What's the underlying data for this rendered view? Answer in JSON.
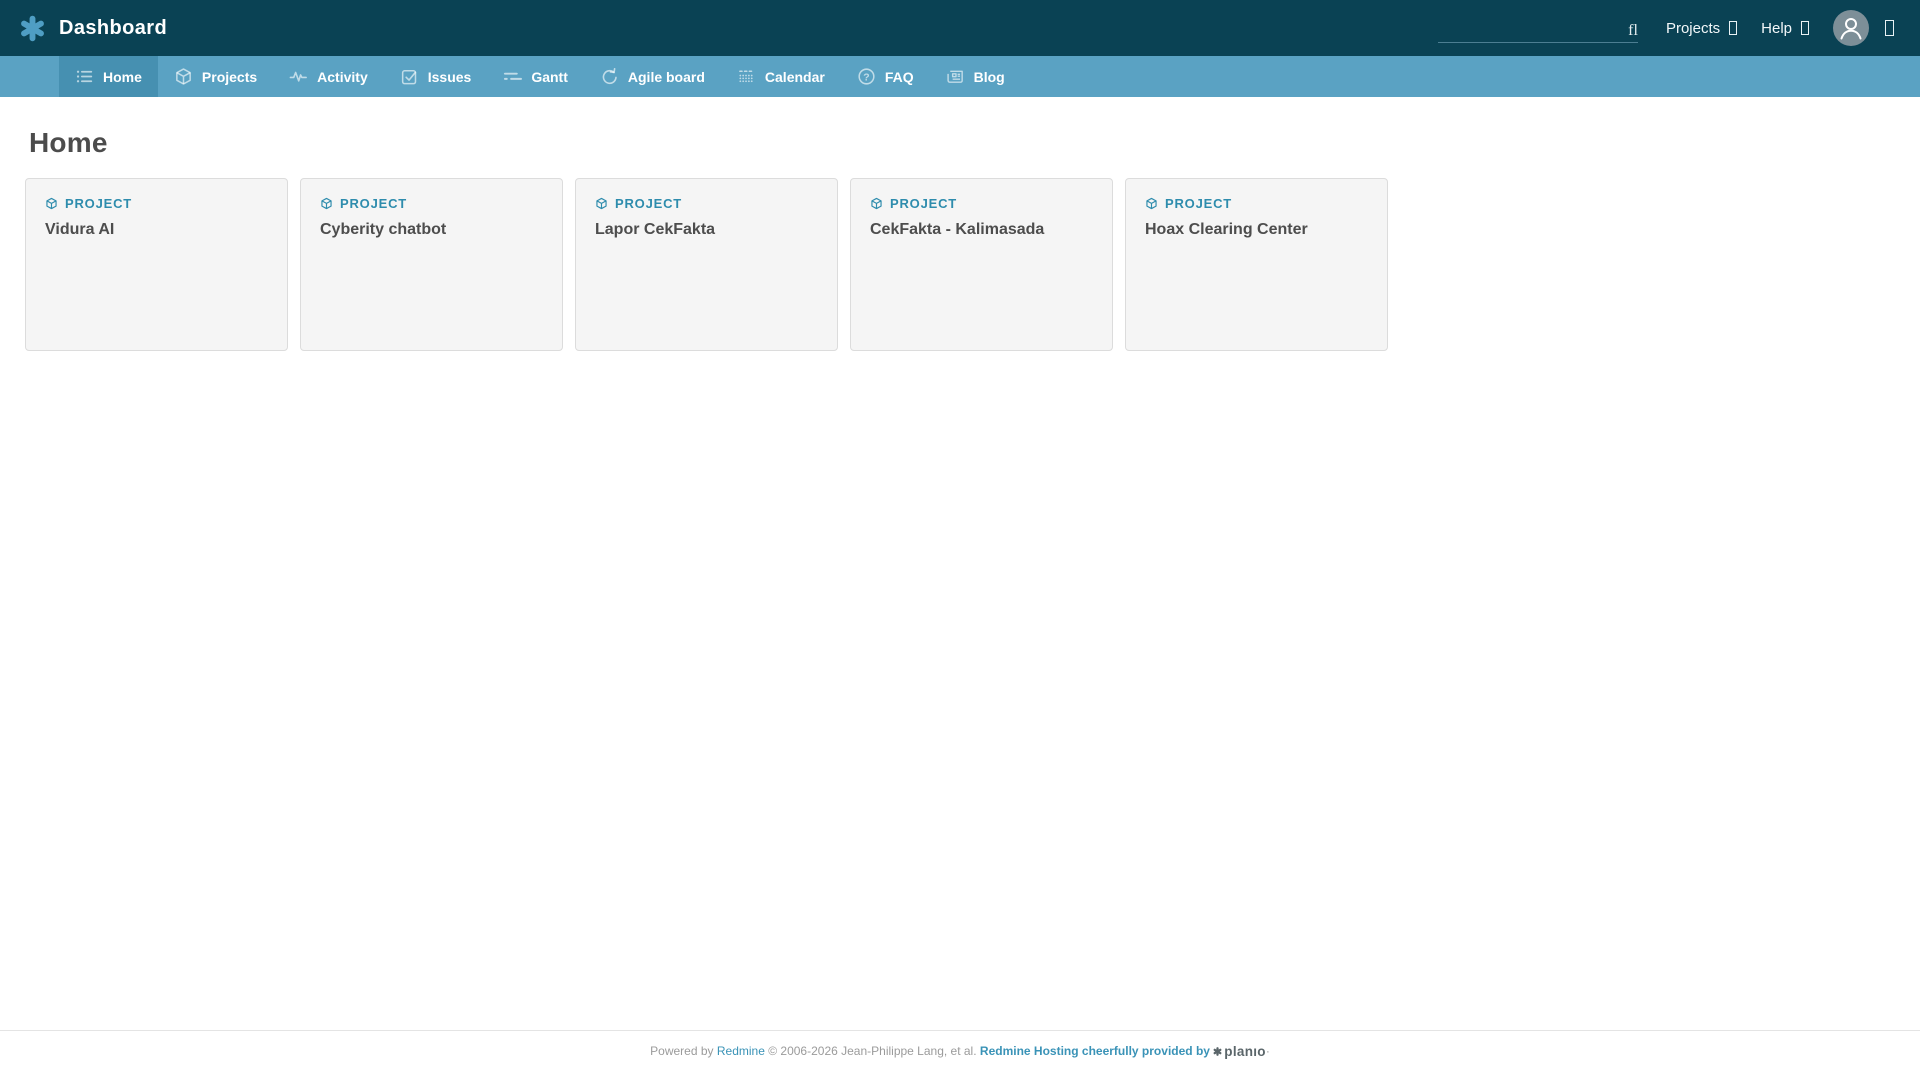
{
  "header": {
    "title": "Dashboard",
    "search_icon_glyph": "fl",
    "menus": [
      {
        "label": "Projects"
      },
      {
        "label": "Help"
      }
    ]
  },
  "nav": {
    "tabs": [
      {
        "label": "Home",
        "icon": "list-icon",
        "active": true
      },
      {
        "label": "Projects",
        "icon": "cube-icon",
        "active": false
      },
      {
        "label": "Activity",
        "icon": "pulse-icon",
        "active": false
      },
      {
        "label": "Issues",
        "icon": "check-square-icon",
        "active": false
      },
      {
        "label": "Gantt",
        "icon": "gantt-bars-icon",
        "active": false
      },
      {
        "label": "Agile board",
        "icon": "sprint-cycle-icon",
        "active": false
      },
      {
        "label": "Calendar",
        "icon": "calendar-dots-icon",
        "active": false
      },
      {
        "label": "FAQ",
        "icon": "question-circle-icon",
        "active": false
      },
      {
        "label": "Blog",
        "icon": "newspaper-icon",
        "active": false
      }
    ]
  },
  "main": {
    "heading": "Home",
    "cards": [
      {
        "type_label": "PROJECT",
        "name": "Vidura AI"
      },
      {
        "type_label": "PROJECT",
        "name": "Cyberity chatbot"
      },
      {
        "type_label": "PROJECT",
        "name": "Lapor CekFakta"
      },
      {
        "type_label": "PROJECT",
        "name": "CekFakta - Kalimasada"
      },
      {
        "type_label": "PROJECT",
        "name": "Hoax Clearing Center"
      }
    ]
  },
  "footer": {
    "powered_by": "Powered by",
    "redmine_link": "Redmine",
    "copyright": "© 2006-2026 Jean-Philippe Lang, et al.",
    "hosting_link": "Redmine Hosting cheerfully provided by",
    "planio_word": "planıo",
    "trailing_dot": "·"
  },
  "colors": {
    "header_bg": "#0a4254",
    "nav_bg": "#5aa2c3",
    "nav_active_bg": "#4690b1",
    "logo_blue": "#4f9ec4",
    "accent_teal": "#2e8cad",
    "link_teal": "#3a93b7",
    "card_bg": "#f5f5f5",
    "card_border": "#dcdcdc",
    "heading_text": "#4c4c4c",
    "footer_text": "#9b9b9b",
    "avatar_bg": "#7d8f98"
  }
}
